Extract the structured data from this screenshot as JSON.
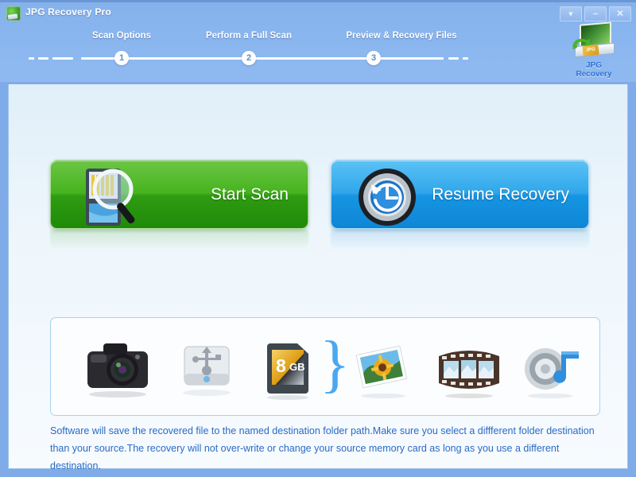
{
  "window": {
    "title": "JPG Recovery Pro",
    "app_icon": "app-logo-icon",
    "controls": [
      {
        "name": "dropdown-button",
        "glyph": "▼"
      },
      {
        "name": "minimize-button",
        "glyph": "–"
      },
      {
        "name": "close-button",
        "glyph": "✕"
      }
    ]
  },
  "steps": [
    {
      "number": "1",
      "label": "Scan Options"
    },
    {
      "number": "2",
      "label": "Perform a Full Scan"
    },
    {
      "number": "3",
      "label": "Preview & Recovery Files"
    }
  ],
  "brand": {
    "line1": "JPG",
    "line2": "Recovery",
    "card_label": "JPG"
  },
  "actions": {
    "start_scan": {
      "label": "Start Scan",
      "icon": "memory-card-magnifier-icon",
      "color": "#2f9c12"
    },
    "resume_recovery": {
      "label": "Resume Recovery",
      "icon": "clock-history-icon",
      "color": "#1695e2"
    }
  },
  "devices": {
    "sources": [
      {
        "name": "camera-icon",
        "label": "Camera"
      },
      {
        "name": "usb-drive-icon",
        "label": "USB Drive"
      },
      {
        "name": "sd-card-icon",
        "label": "SD Card",
        "capacity": "8",
        "capacity_unit": "GB"
      }
    ],
    "separator": "}",
    "outputs": [
      {
        "name": "photos-icon",
        "label": "Photos"
      },
      {
        "name": "video-film-icon",
        "label": "Video"
      },
      {
        "name": "audio-speaker-icon",
        "label": "Audio"
      }
    ]
  },
  "note": {
    "text": "Software will save the recovered file to the named destination folder path.Make sure you select a diffferent folder destination than your source.The recovery will not over-write or change your source memory card as long as you use a different destination."
  },
  "colors": {
    "header": "#8ab6ef",
    "accent_green": "#2f9c12",
    "accent_blue": "#1695e2",
    "note_text": "#2a6bc4"
  }
}
